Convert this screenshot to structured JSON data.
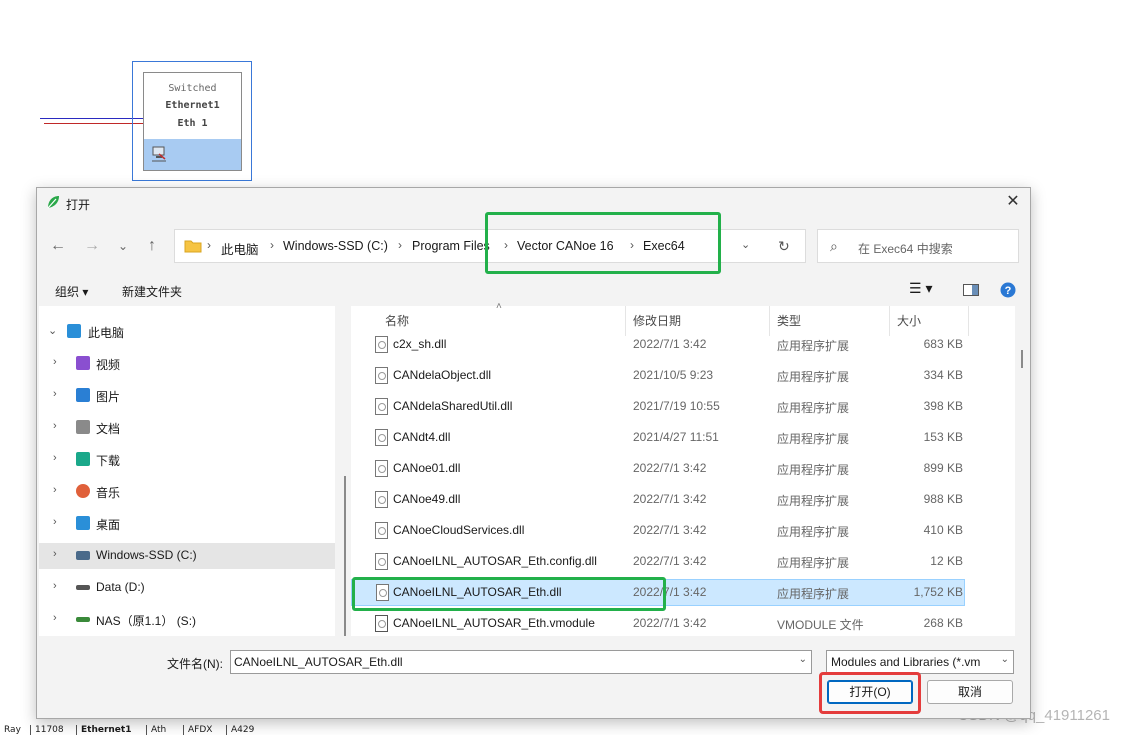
{
  "canvas": {
    "node": {
      "line1": "Switched",
      "line2": "Ethernet1",
      "line3": "Eth 1"
    },
    "bottom_tabs": [
      "Ray",
      "11708",
      "Ethernet1",
      "Ath",
      "AFDX",
      "A429"
    ]
  },
  "watermark": "CSDN @qq_41911261",
  "dialog": {
    "title": "打开",
    "nav": {
      "back": "←",
      "forward": "→",
      "recent": "⌄",
      "up": "↑",
      "dropdown": "⌄",
      "refresh": "↻"
    },
    "breadcrumb": [
      "此电脑",
      "Windows-SSD (C:)",
      "Program Files",
      "Vector CANoe 16",
      "Exec64"
    ],
    "search": {
      "placeholder": "在 Exec64 中搜索"
    },
    "toolbar": {
      "organize": "组织 ▾",
      "new_folder": "新建文件夹"
    },
    "tree": [
      {
        "label": "此电脑",
        "icon": "computer-icon",
        "color": "#2a8fd8"
      },
      {
        "label": "视频",
        "icon": "video-icon",
        "color": "#8a4fd0"
      },
      {
        "label": "图片",
        "icon": "picture-icon",
        "color": "#2a7fd4"
      },
      {
        "label": "文档",
        "icon": "document-icon",
        "color": "#8a8a8a"
      },
      {
        "label": "下载",
        "icon": "download-icon",
        "color": "#1aa88a"
      },
      {
        "label": "音乐",
        "icon": "music-icon",
        "color": "#e0603a"
      },
      {
        "label": "桌面",
        "icon": "desktop-icon",
        "color": "#2a8fd8"
      },
      {
        "label": "Windows-SSD (C:)",
        "icon": "drive-icon",
        "color": "#4a6a8a"
      },
      {
        "label": "Data (D:)",
        "icon": "drive-icon",
        "color": "#555555"
      },
      {
        "label": "NAS（原1.1）  (S:)",
        "icon": "network-drive-icon",
        "color": "#3a8a3a"
      }
    ],
    "columns": {
      "name": "名称",
      "date": "修改日期",
      "type": "类型",
      "size": "大小"
    },
    "files": [
      {
        "name": "c2x_sh.dll",
        "date": "2022/7/1 3:42",
        "type": "应用程序扩展",
        "size": "683 KB"
      },
      {
        "name": "CANdelaObject.dll",
        "date": "2021/10/5 9:23",
        "type": "应用程序扩展",
        "size": "334 KB"
      },
      {
        "name": "CANdelaSharedUtil.dll",
        "date": "2021/7/19 10:55",
        "type": "应用程序扩展",
        "size": "398 KB"
      },
      {
        "name": "CANdt4.dll",
        "date": "2021/4/27 11:51",
        "type": "应用程序扩展",
        "size": "153 KB"
      },
      {
        "name": "CANoe01.dll",
        "date": "2022/7/1 3:42",
        "type": "应用程序扩展",
        "size": "899 KB"
      },
      {
        "name": "CANoe49.dll",
        "date": "2022/7/1 3:42",
        "type": "应用程序扩展",
        "size": "988 KB"
      },
      {
        "name": "CANoeCloudServices.dll",
        "date": "2022/7/1 3:42",
        "type": "应用程序扩展",
        "size": "410 KB"
      },
      {
        "name": "CANoeILNL_AUTOSAR_Eth.config.dll",
        "date": "2022/7/1 3:42",
        "type": "应用程序扩展",
        "size": "12 KB"
      },
      {
        "name": "CANoeILNL_AUTOSAR_Eth.dll",
        "date": "2022/7/1 3:42",
        "type": "应用程序扩展",
        "size": "1,752 KB"
      },
      {
        "name": "CANoeILNL_AUTOSAR_Eth.vmodule",
        "date": "2022/7/1 3:42",
        "type": "VMODULE 文件",
        "size": "268 KB"
      }
    ],
    "selected_file_index": 8,
    "filename_label": "文件名(N):",
    "filename_value": "CANoeILNL_AUTOSAR_Eth.dll",
    "filter_value": "Modules and Libraries (*.vm",
    "open_button": "打开(O)",
    "cancel_button": "取消"
  }
}
